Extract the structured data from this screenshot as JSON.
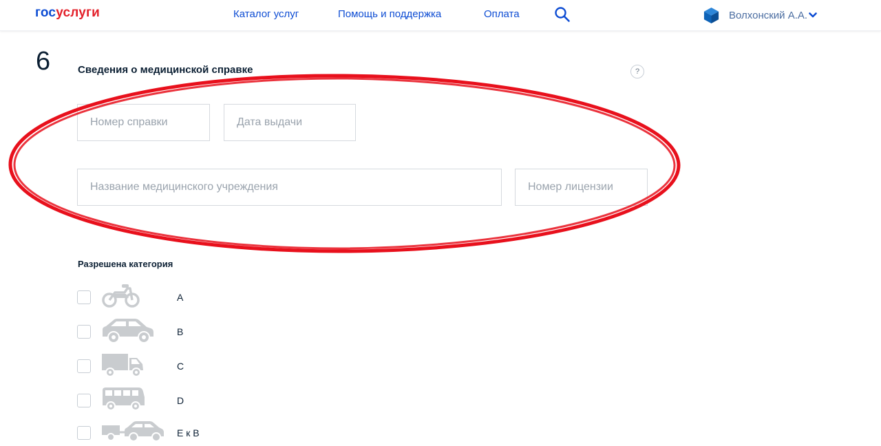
{
  "header": {
    "logo_part1": "гос",
    "logo_part2": "услуги",
    "nav": [
      "Каталог услуг",
      "Помощь и поддержка",
      "Оплата"
    ],
    "user_name": "Волхонский А.А.",
    "search_icon": "search-icon",
    "user_icon": "user-cube-icon",
    "chevron_icon": "chevron-down-icon"
  },
  "section": {
    "step": "6",
    "title": "Сведения о медицинской справке",
    "help": "?"
  },
  "fields": {
    "cert_number": {
      "placeholder": "Номер справки",
      "value": ""
    },
    "issue_date": {
      "placeholder": "Дата выдачи",
      "value": ""
    },
    "institution": {
      "placeholder": "Название медицинского учреждения",
      "value": ""
    },
    "license_number": {
      "placeholder": "Номер лицензии",
      "value": ""
    }
  },
  "categories": {
    "title": "Разрешена категория",
    "items": [
      {
        "label": "A",
        "icon": "motorcycle-icon",
        "checked": false
      },
      {
        "label": "B",
        "icon": "car-icon",
        "checked": false
      },
      {
        "label": "C",
        "icon": "truck-icon",
        "checked": false
      },
      {
        "label": "D",
        "icon": "bus-icon",
        "checked": false
      },
      {
        "label": "E к B",
        "icon": "car-trailer-icon",
        "checked": false
      }
    ]
  },
  "colors": {
    "brand_blue": "#0d4cd3",
    "brand_red": "#e3202a",
    "annotation_red": "#e8101c",
    "vehicle_gray": "#c9cccf"
  }
}
